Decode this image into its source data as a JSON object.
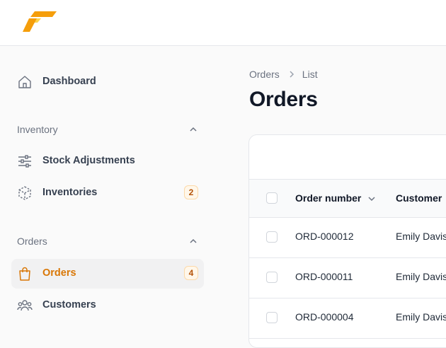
{
  "sidebar": {
    "dashboard": {
      "label": "Dashboard",
      "icon": "home-icon"
    },
    "groups": [
      {
        "label": "Inventory",
        "items": [
          {
            "label": "Stock Adjustments",
            "icon": "sliders-icon"
          },
          {
            "label": "Inventories",
            "icon": "cube-icon",
            "badge": "2"
          }
        ]
      },
      {
        "label": "Orders",
        "items": [
          {
            "label": "Orders",
            "icon": "shopping-bag-icon",
            "badge": "4",
            "active": true
          },
          {
            "label": "Customers",
            "icon": "users-icon"
          }
        ]
      }
    ]
  },
  "breadcrumb": [
    "Orders",
    "List"
  ],
  "page_title": "Orders",
  "table": {
    "columns": [
      "Order number",
      "Customer"
    ],
    "rows": [
      {
        "order_number": "ORD-000012",
        "customer": "Emily Davis"
      },
      {
        "order_number": "ORD-000011",
        "customer": "Emily Davis"
      },
      {
        "order_number": "ORD-000004",
        "customer": "Emily Davis"
      }
    ]
  },
  "colors": {
    "accent": "#d97706",
    "logo_primary": "#f59e0b",
    "logo_secondary": "#fcd34d",
    "badge_bg": "#fff7ea",
    "border": "#e5e7eb"
  }
}
